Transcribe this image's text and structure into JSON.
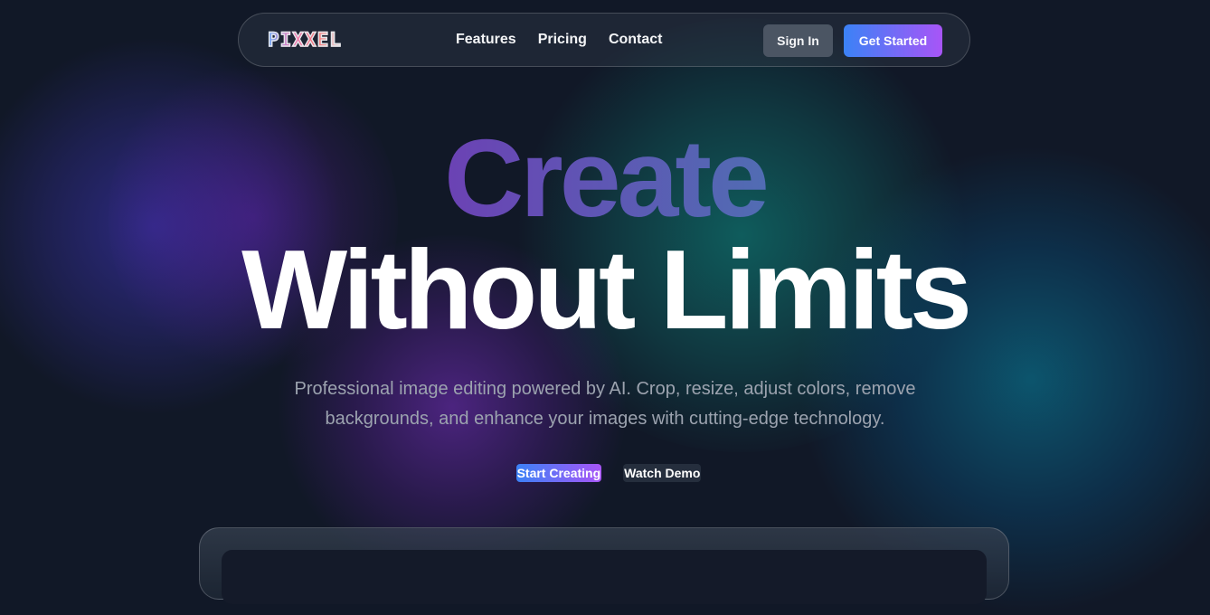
{
  "brand": {
    "logo_text": "PIXXEL"
  },
  "nav": {
    "links": [
      "Features",
      "Pricing",
      "Contact"
    ],
    "sign_in_label": "Sign In",
    "get_started_label": "Get Started"
  },
  "hero": {
    "headline_line1": "Create",
    "headline_line2": "Without Limits",
    "subtitle_line1": "Professional image editing powered by AI. Crop, resize, adjust colors, remove",
    "subtitle_line2": "backgrounds, and enhance your images with cutting-edge technology.",
    "primary_cta_label": "Start Creating",
    "secondary_cta_label": "Watch Demo"
  },
  "colors": {
    "background": "#111827",
    "accent_gradient_start": "#3b82f6",
    "accent_gradient_end": "#a855f7",
    "subtitle_text": "#9ca3af"
  }
}
